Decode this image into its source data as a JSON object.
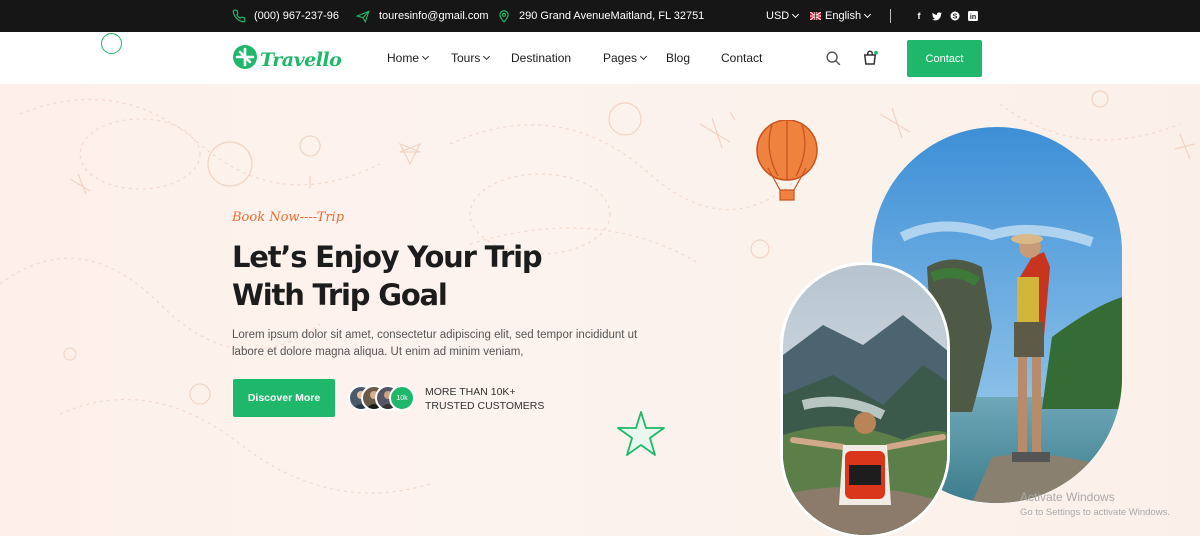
{
  "topbar": {
    "phone": "(000) 967-237-96",
    "email": "touresinfo@gmail.com",
    "address": "290 Grand AvenueMaitland, FL 32751",
    "currency": "USD",
    "language": "English",
    "social_icons": [
      "facebook-icon",
      "twitter-icon",
      "skype-icon",
      "linkedin-icon"
    ]
  },
  "nav": {
    "logo_text": "Travello",
    "items": [
      {
        "label": "Home",
        "dropdown": true
      },
      {
        "label": "Tours",
        "dropdown": true
      },
      {
        "label": "Destination",
        "dropdown": false
      },
      {
        "label": "Pages",
        "dropdown": true
      },
      {
        "label": "Blog",
        "dropdown": false
      },
      {
        "label": "Contact",
        "dropdown": false
      }
    ],
    "contact_button": "Contact"
  },
  "hero": {
    "tagline": "Book Now----Trip",
    "headline_line1": "Let’s Enjoy Your Trip",
    "headline_line2": "With Trip Goal",
    "description": "Lorem ipsum dolor sit amet, consectetur adipiscing elit, sed tempor incididunt ut labore et dolore magna aliqua. Ut enim ad minim veniam,",
    "cta_label": "Discover More",
    "customer_count_badge": "10k",
    "trust_line1": "MORE THAN 10K+",
    "trust_line2": "TRUSTED CUSTOMERS"
  },
  "watermark": {
    "line1": "Activate Windows",
    "line2": "Go to Settings to activate Windows."
  },
  "colors": {
    "accent": "#1fb86b",
    "tag_orange": "#ef6c33",
    "topbar_bg": "#161616",
    "hero_bg": "#fdf1ec"
  }
}
